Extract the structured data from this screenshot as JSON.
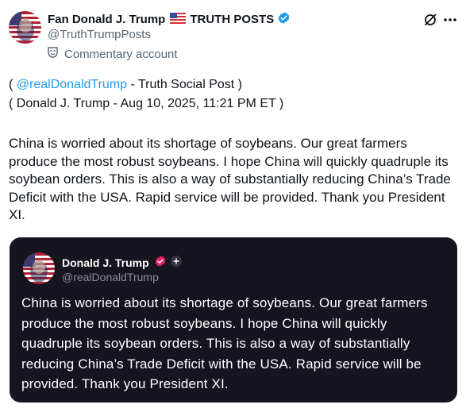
{
  "tweet": {
    "display_name": "Fan Donald J. Trump",
    "flag_icon": "us-flag-icon",
    "name_suffix": "TRUTH POSTS",
    "handle": "@TruthTrumpPosts",
    "commentary_label": "Commentary account",
    "source_open": "( ",
    "source_mention": "@realDonaldTrump",
    "source_rest": " - Truth Social Post )",
    "source_line2": "( Donald J. Trump - Aug 10, 2025, 11:21 PM ET )",
    "body": "China is worried about its shortage of soybeans. Our great farmers produce the most robust soybeans. I hope China will quickly quadruple its soybean orders. This is also a way of substantially reducing China’s Trade Deficit with the USA. Rapid service will be provided. Thank you President XI."
  },
  "quote": {
    "display_name": "Donald J. Trump",
    "handle": "@realDonaldTrump",
    "text": "China is worried about its shortage of soybeans. Our great farmers produce the most robust soybeans. I hope China will quickly quadruple its soybean orders. This is also a way of substantially reducing China’s Trade Deficit with the USA. Rapid service will be provided. Thank you President XI."
  },
  "colors": {
    "link": "#1d9bf0",
    "verified": "#1d9bf0",
    "quote_bg": "#15141f",
    "quote_badge": "#e0245e"
  }
}
